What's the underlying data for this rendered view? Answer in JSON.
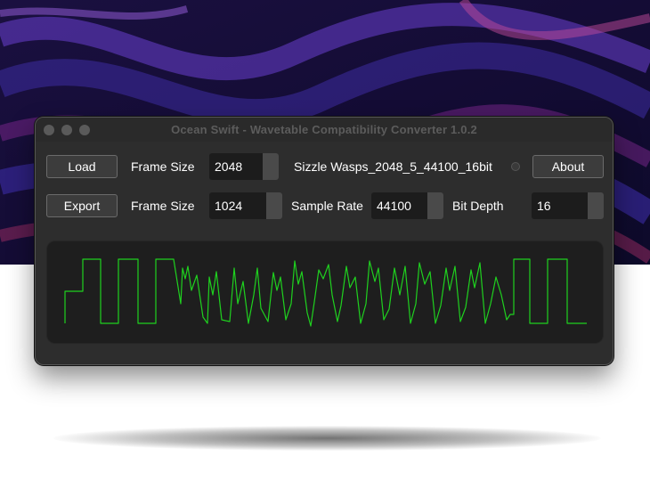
{
  "window": {
    "title": "Ocean Swift - Wavetable Compatibility Converter 1.0.2"
  },
  "input_row": {
    "load_label": "Load",
    "frame_size_label": "Frame Size",
    "frame_size_value": "2048",
    "file_name": "Sizzle Wasps_2048_5_44100_16bit",
    "about_label": "About"
  },
  "output_row": {
    "export_label": "Export",
    "frame_size_label": "Frame Size",
    "frame_size_value": "1024",
    "sample_rate_label": "Sample Rate",
    "sample_rate_value": "44100",
    "bit_depth_label": "Bit Depth",
    "bit_depth_value": "16"
  },
  "waveform": {
    "color": "#1fd11f",
    "frame_count": 5
  },
  "colors": {
    "window_bg": "#2d2d2d",
    "panel_bg": "#1e1e1e",
    "waveform": "#1fd11f"
  }
}
